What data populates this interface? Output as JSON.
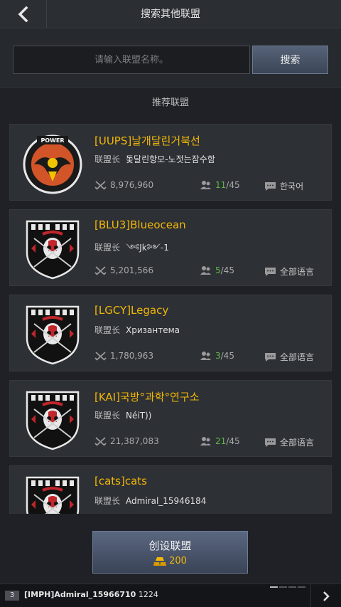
{
  "header": {
    "title": "搜索其他联盟"
  },
  "search": {
    "placeholder": "请输入联盟名称。",
    "button_label": "搜索"
  },
  "section": {
    "title": "推荐联盟"
  },
  "labels": {
    "leader_prefix": "联盟长"
  },
  "alliances": [
    {
      "name": "[UUPS]날개달린거북선",
      "leader": "돛달린항모-노젓는잠수함",
      "power": "8,976,960",
      "members_current": "11",
      "members_max": "/45",
      "language": "한국어",
      "emblem": "power-emblem-icon",
      "members_highlight": "#5dbb46"
    },
    {
      "name": "[BLU3]Blueocean",
      "leader": "༺Jk༻-1",
      "power": "5,201,566",
      "members_current": "5",
      "members_max": "/45",
      "language": "全部语言",
      "emblem": "skull-crest-emblem-icon",
      "members_highlight": "#5dbb46"
    },
    {
      "name": "[LGCY]Legacy",
      "leader": "Хризантема",
      "power": "1,780,963",
      "members_current": "3",
      "members_max": "/45",
      "language": "全部语言",
      "emblem": "skull-crest-emblem-icon",
      "members_highlight": "#5dbb46"
    },
    {
      "name": "[KAI]국방°과학°연구소",
      "leader": "NéiT))",
      "power": "21,387,083",
      "members_current": "21",
      "members_max": "/45",
      "language": "全部语言",
      "emblem": "skull-crest-emblem-icon",
      "members_highlight": "#5dbb46"
    },
    {
      "name": "[cats]cats",
      "leader": "Admiral_15946184",
      "emblem": "skull-crest-emblem-icon"
    }
  ],
  "create": {
    "label": "创设联盟",
    "cost": "200"
  },
  "chat": {
    "channel": "3",
    "sender": "[IMPH]Admiral_15966710",
    "message": "1224",
    "pages": 4,
    "active_page": 1
  }
}
